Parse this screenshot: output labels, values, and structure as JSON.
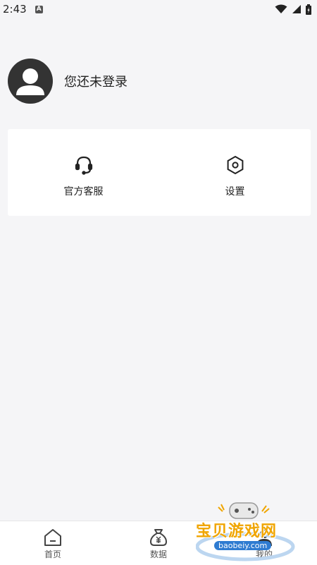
{
  "status_bar": {
    "time": "2:43",
    "notification_icon": "a-badge-icon",
    "notification_glyph": "A",
    "icons": [
      "wifi-icon",
      "signal-icon",
      "battery-icon"
    ]
  },
  "profile": {
    "avatar_icon": "user-avatar-icon",
    "login_text": "您还未登录"
  },
  "menu": {
    "items": [
      {
        "label": "官方客服",
        "icon": "headset-icon"
      },
      {
        "label": "设置",
        "icon": "settings-hexagon-icon"
      }
    ]
  },
  "tab_bar": {
    "tabs": [
      {
        "label": "首页",
        "icon": "home-icon"
      },
      {
        "label": "数据",
        "icon": "money-bag-icon"
      },
      {
        "label": "我的",
        "icon": "user-icon",
        "active": true
      }
    ]
  },
  "watermark": {
    "text": "宝贝游戏网",
    "url": "baobeiy.com"
  },
  "colors": {
    "background": "#f5f5f7",
    "card": "#ffffff",
    "avatar": "#333333",
    "text": "#222222"
  }
}
